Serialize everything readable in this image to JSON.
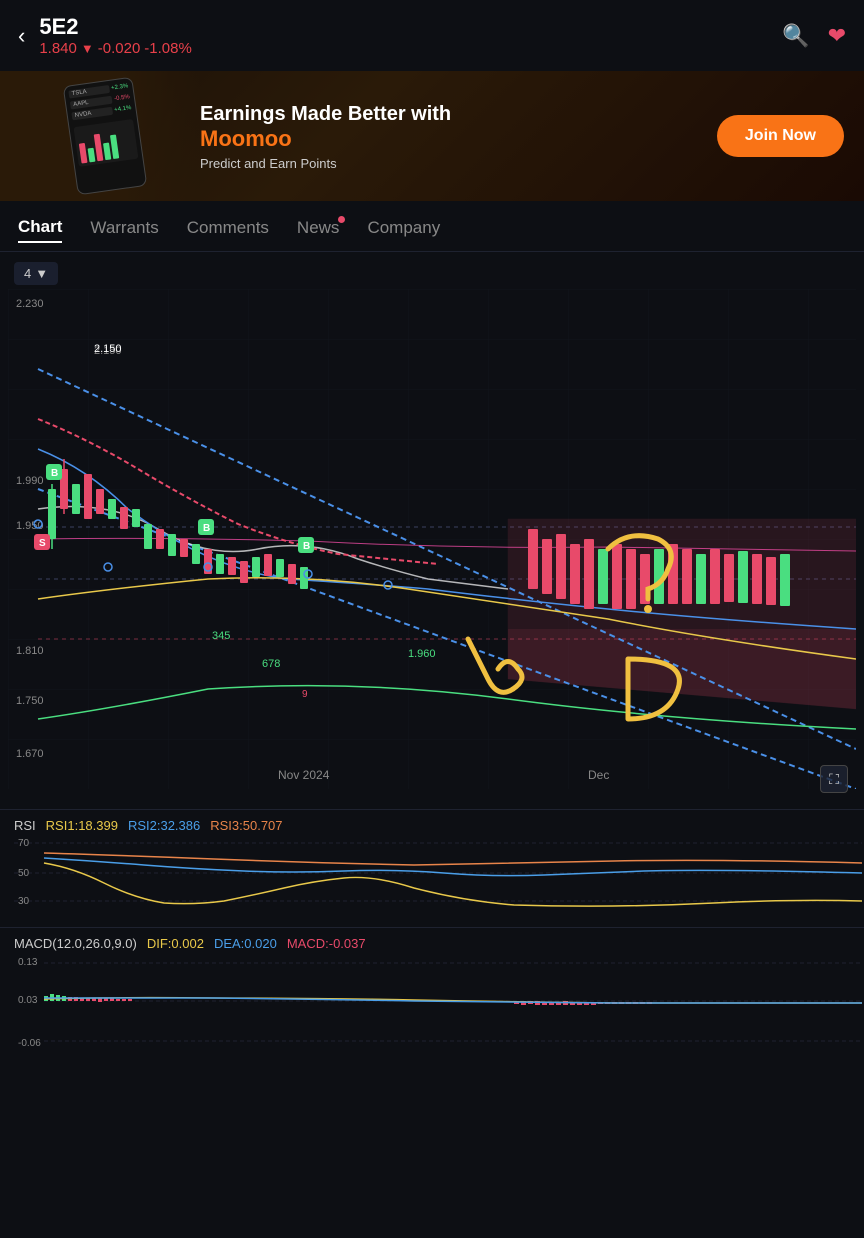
{
  "header": {
    "back_label": "‹",
    "symbol": "5E2",
    "price": "1.840",
    "change": "-0.020",
    "change_pct": "-1.08%",
    "search_icon": "search",
    "heart_icon": "heart"
  },
  "banner": {
    "title": "Earnings Made Better with",
    "brand": "Moomoo",
    "subtitle": "Predict and Earn Points",
    "cta": "Join Now",
    "tickers": [
      {
        "name": "TSLA",
        "value": "+2.3%",
        "color": "green"
      },
      {
        "name": "AAPL",
        "value": "-0.5%",
        "color": "red"
      },
      {
        "name": "NVDA",
        "value": "+4.1%",
        "color": "green"
      }
    ]
  },
  "tabs": [
    {
      "label": "Chart",
      "active": true,
      "dot": false
    },
    {
      "label": "Warrants",
      "active": false,
      "dot": false
    },
    {
      "label": "Comments",
      "active": false,
      "dot": false
    },
    {
      "label": "News",
      "active": false,
      "dot": true
    },
    {
      "label": "Company",
      "active": false,
      "dot": false
    }
  ],
  "chart": {
    "period": "4",
    "price_levels": [
      "2.230",
      "2.150",
      "1.990",
      "1.950",
      "1.810",
      "1.750",
      "1.670"
    ],
    "x_labels": [
      "Nov 2024",
      "Dec"
    ],
    "fullscreen_icon": "expand"
  },
  "rsi": {
    "title": "RSI",
    "values": [
      {
        "label": "RSI1:",
        "value": "18.399",
        "color": "orange"
      },
      {
        "label": "RSI2:",
        "value": "32.386",
        "color": "cyan"
      },
      {
        "label": "RSI3:",
        "value": "50.707",
        "color": "orange-red"
      }
    ],
    "levels": [
      "70",
      "50",
      "30"
    ]
  },
  "macd": {
    "title": "MACD(12.0,26.0,9.0)",
    "dif_label": "DIF:",
    "dif_value": "0.002",
    "dea_label": "DEA:",
    "dea_value": "0.020",
    "macd_label": "MACD:",
    "macd_value": "-0.037",
    "levels": [
      "0.13",
      "0.03",
      "-0.06"
    ]
  }
}
